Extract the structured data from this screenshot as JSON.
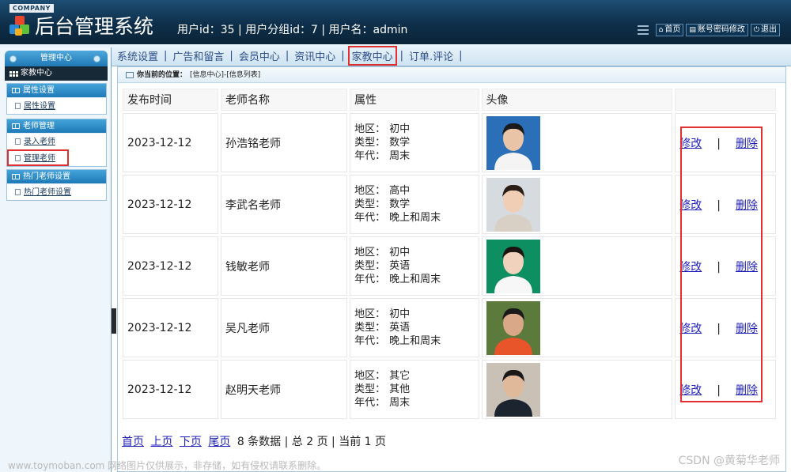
{
  "header": {
    "company": "COMPANY",
    "title": "后台管理系统",
    "user_info": "用户id：35 | 用户分组id：7 | 用户名：admin",
    "buttons": [
      {
        "label": "首页",
        "icon": "home-icon"
      },
      {
        "label": "账号密码修改",
        "icon": "account-icon"
      },
      {
        "label": "退出",
        "icon": "power-icon"
      }
    ]
  },
  "nav": {
    "items": [
      "系统设置",
      "广告和留言",
      "会员中心",
      "资讯中心",
      "家教中心",
      "订单.评论"
    ],
    "active": "家教中心"
  },
  "sidebar": {
    "header": "管理中心",
    "section": "家教中心",
    "groups": [
      {
        "title": "属性设置",
        "items": [
          "属性设置"
        ]
      },
      {
        "title": "老师管理",
        "items": [
          "录入老师",
          "管理老师"
        ]
      },
      {
        "title": "热门老师设置",
        "items": [
          "热门老师设置"
        ]
      }
    ]
  },
  "breadcrumb": {
    "label": "你当前的位置：",
    "path": "[信息中心]-[信息列表]"
  },
  "table": {
    "columns": [
      "发布时间",
      "老师名称",
      "属性",
      "头像",
      ""
    ],
    "attr_keys": [
      "地区：",
      "类型：",
      "年代："
    ],
    "rows": [
      {
        "date": "2023-12-12",
        "name": "孙浩铭老师",
        "region": "初中",
        "type": "数学",
        "era": "周末"
      },
      {
        "date": "2023-12-12",
        "name": "李武名老师",
        "region": "高中",
        "type": "数学",
        "era": "晚上和周末"
      },
      {
        "date": "2023-12-12",
        "name": "钱敏老师",
        "region": "初中",
        "type": "英语",
        "era": "晚上和周末"
      },
      {
        "date": "2023-12-12",
        "name": "吴凡老师",
        "region": "初中",
        "type": "英语",
        "era": "晚上和周末"
      },
      {
        "date": "2023-12-12",
        "name": "赵明天老师",
        "region": "其它",
        "type": "其他",
        "era": "周末"
      }
    ],
    "edit_label": "修改",
    "separator": "|",
    "delete_label": "删除"
  },
  "pager": {
    "first": "首页",
    "prev": "上页",
    "next": "下页",
    "last": "尾页",
    "summary": "8 条数据 | 总 2 页 | 当前 1 页"
  },
  "watermarks": {
    "left": "www.toymoban.com 网络图片仅供展示，非存储，如有侵权请联系删除。",
    "right": "CSDN @黄菊华老师"
  },
  "colors": {
    "header_bg": "#0e2f4a",
    "accent_blue": "#1f78b4",
    "highlight_red": "#e03030",
    "link": "#1d1db8"
  }
}
